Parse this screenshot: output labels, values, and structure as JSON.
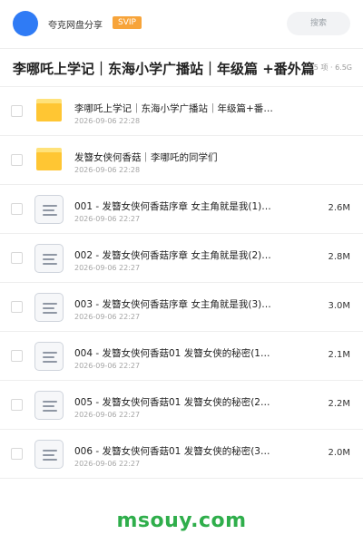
{
  "header": {
    "username": "夸克网盘分享",
    "badge": "SVIP",
    "search_placeholder": "搜索"
  },
  "share": {
    "title": "李哪吒上学记｜东海小学广播站｜年级篇 +番外篇",
    "meta": "85 项 · 6.5G"
  },
  "files": [
    {
      "type": "folder",
      "name": "李哪吒上学记｜东海小学广播站｜年级篇+番外篇",
      "date": "2026-09-06 22:28",
      "size": ""
    },
    {
      "type": "folder",
      "name": "发簪女侠何香菇｜李哪吒的同学们",
      "date": "2026-09-06 22:28",
      "size": ""
    },
    {
      "type": "file",
      "name": "001 - 发簪女侠何香菇序章 女主角就是我(1)…",
      "date": "2026-09-06 22:27",
      "size": "2.6M"
    },
    {
      "type": "file",
      "name": "002 - 发簪女侠何香菇序章 女主角就是我(2)…",
      "date": "2026-09-06 22:27",
      "size": "2.8M"
    },
    {
      "type": "file",
      "name": "003 - 发簪女侠何香菇序章 女主角就是我(3)…",
      "date": "2026-09-06 22:27",
      "size": "3.0M"
    },
    {
      "type": "file",
      "name": "004 - 发簪女侠何香菇01 发簪女侠的秘密(1…",
      "date": "2026-09-06 22:27",
      "size": "2.1M"
    },
    {
      "type": "file",
      "name": "005 - 发簪女侠何香菇01 发簪女侠的秘密(2…",
      "date": "2026-09-06 22:27",
      "size": "2.2M"
    },
    {
      "type": "file",
      "name": "006 - 发簪女侠何香菇01 发簪女侠的秘密(3…",
      "date": "2026-09-06 22:27",
      "size": "2.0M"
    }
  ],
  "watermark": "msouy.com",
  "colors": {
    "accent": "#2f7bf5",
    "svip": "#f7a43a",
    "folder": "#ffc633",
    "watermark": "#2fae4b"
  }
}
